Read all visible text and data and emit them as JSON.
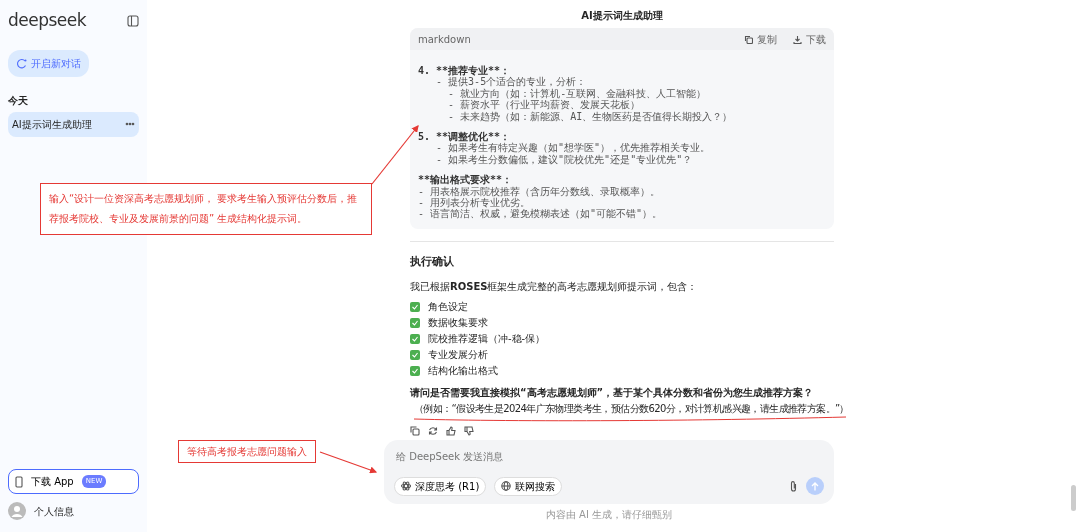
{
  "sidebar": {
    "logo": "deepseek",
    "new_chat_button": "开启新对话",
    "section_label": "今天",
    "conversations": [
      {
        "title": "AI提示词生成助理",
        "selected": true
      }
    ],
    "download_button": {
      "label": "下载 App",
      "badge": "NEW"
    },
    "profile_label": "个人信息"
  },
  "chat": {
    "title": "AI提示词生成助理",
    "code_block": {
      "language": "markdown",
      "copy_label": "复制",
      "download_label": "下载",
      "lines": [
        {
          "kind": "heading",
          "text": "4. **推荐专业**："
        },
        {
          "kind": "item",
          "text": "   - 提供3-5个适合的专业，分析："
        },
        {
          "kind": "item",
          "text": "     - 就业方向（如：计算机-互联网、金融科技、人工智能）"
        },
        {
          "kind": "item",
          "text": "     - 薪资水平（行业平均薪资、发展天花板）"
        },
        {
          "kind": "item",
          "text": "     - 未来趋势（如：新能源、AI、生物医药是否值得长期投入？）"
        },
        {
          "kind": "heading",
          "text": "5. **调整优化**："
        },
        {
          "kind": "item",
          "text": "   - 如果考生有特定兴趣（如\"想学医\"），优先推荐相关专业。"
        },
        {
          "kind": "item",
          "text": "   - 如果考生分数偏低，建议\"院校优先\"还是\"专业优先\"？"
        },
        {
          "kind": "heading",
          "text": "**输出格式要求**："
        },
        {
          "kind": "item",
          "text": "- 用表格展示院校推荐（含历年分数线、录取概率）。"
        },
        {
          "kind": "item",
          "text": "- 用列表分析专业优劣。"
        },
        {
          "kind": "item",
          "text": "- 语言简洁、权威，避免模糊表述（如\"可能不错\"）。"
        }
      ]
    },
    "section_heading": "执行确认",
    "intro": "我已根据**ROSES**框架生成完整的高考志愿规划师提示词，包含：",
    "checklist": [
      {
        "label": "角色设定",
        "checked": true
      },
      {
        "label": "数据收集要求",
        "checked": true
      },
      {
        "label": "院校推荐逻辑（冲-稳-保）",
        "checked": true
      },
      {
        "label": "专业发展分析",
        "checked": true
      },
      {
        "label": "结构化输出格式",
        "checked": true
      }
    ],
    "question": "请问是否需要我直接模拟“高考志愿规划师”，基于某个具体分数和省份为您生成推荐方案？",
    "example": "（例如：“假设考生是2024年广东物理类考生，预估分数620分，对计算机感兴趣，请生成推荐方案。”）"
  },
  "composer": {
    "placeholder": "给 DeepSeek 发送消息",
    "toggles": [
      {
        "label": "深度思考 (R1)",
        "on": false
      },
      {
        "label": "联网搜索",
        "on": false
      }
    ]
  },
  "footer_note": "内容由 AI 生成，请仔细甄别",
  "annotations": [
    {
      "text": "输入“设计一位资深高考志愿规划师， 要求考生输入预评估分数后，推荐报考院校、专业及发展前景的问题” 生成结构化提示词。"
    },
    {
      "text": "等待高考报考志愿问题输入"
    }
  ]
}
